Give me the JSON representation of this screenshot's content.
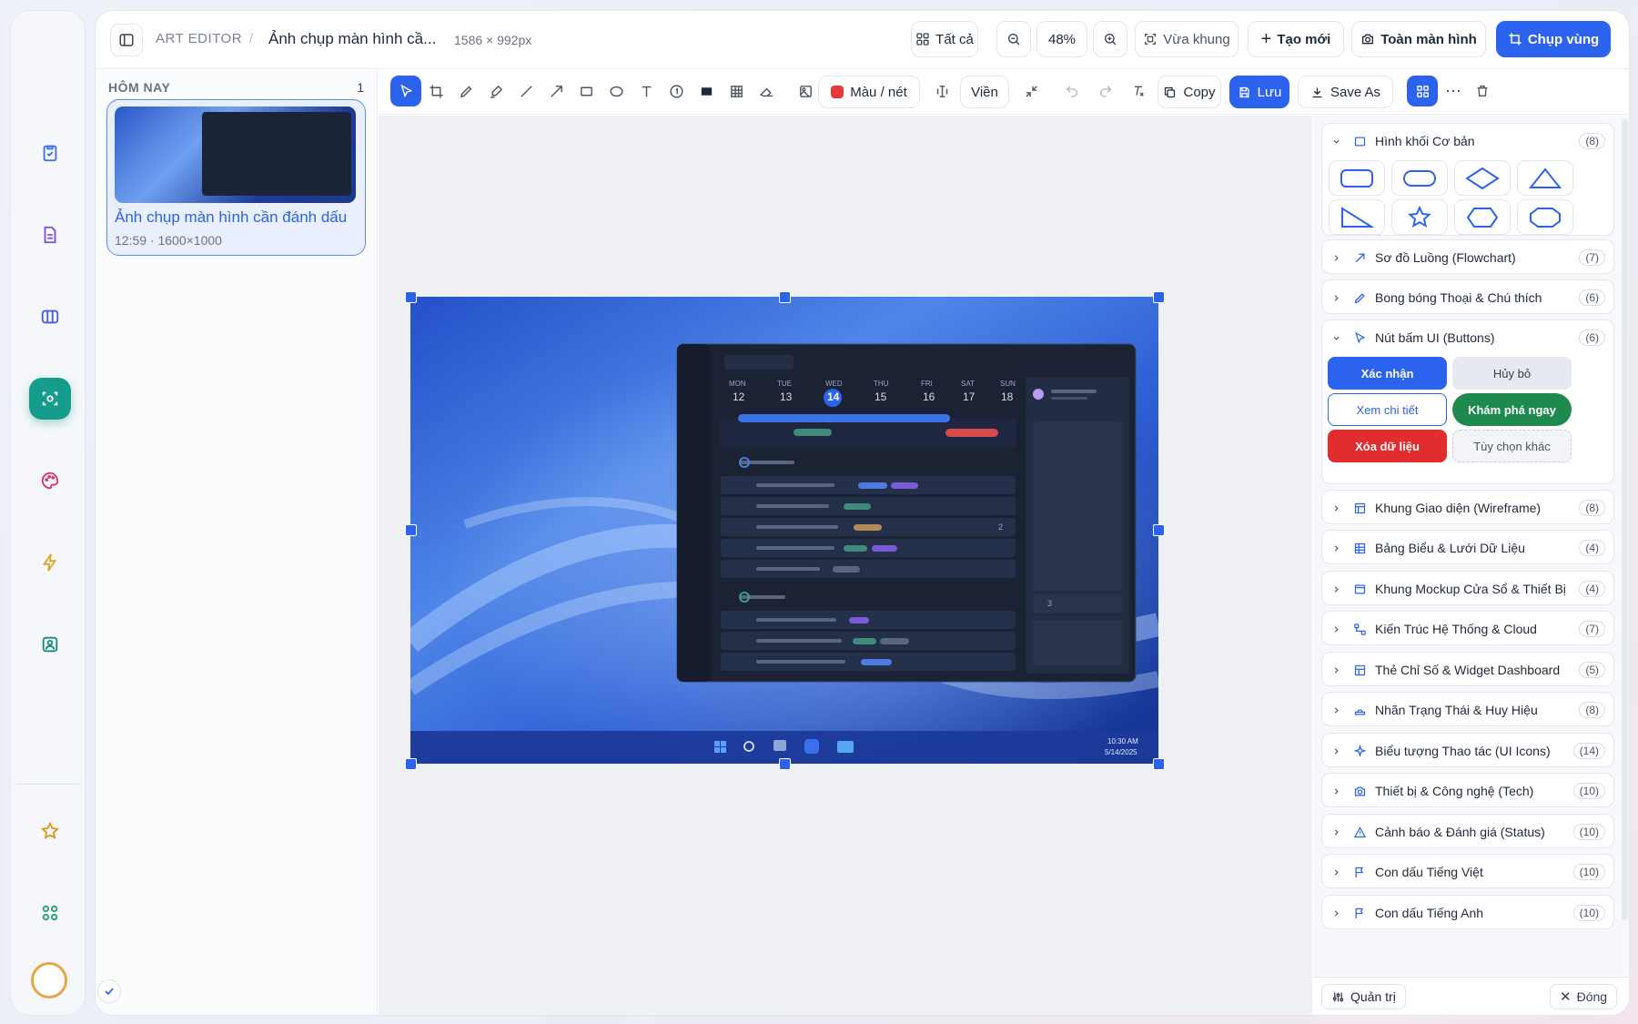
{
  "app": {
    "breadcrumb_root": "ART EDITOR",
    "breadcrumb_sep": "/",
    "doc_title": "Ảnh chụp màn hình cầ...",
    "doc_dims": "1586 × 992px",
    "btn_all": "Tất cả",
    "zoom": "48%",
    "btn_fit": "Vừa khung",
    "btn_new": "Tạo mới",
    "btn_fullscreen": "Toàn màn hình",
    "btn_capture": "Chụp vùng"
  },
  "sidebar": {
    "section": "HÔM NAY",
    "count": "1",
    "item_title": "Ảnh chụp màn hình cần đánh dấu",
    "item_sub": "12:59 · 1600×1000"
  },
  "toolbar": {
    "color_label": "Màu / nét",
    "border_label": "Viền",
    "copy": "Copy",
    "save": "Lưu",
    "save_as": "Save As",
    "accent": "#2c63ee",
    "stroke_color": "#e5383b"
  },
  "screenshot": {
    "days": [
      {
        "d": "MON",
        "n": "12"
      },
      {
        "d": "TUE",
        "n": "13"
      },
      {
        "d": "WED",
        "n": "14"
      },
      {
        "d": "THU",
        "n": "15"
      },
      {
        "d": "FRI",
        "n": "16"
      },
      {
        "d": "SAT",
        "n": "17"
      },
      {
        "d": "SUN",
        "n": "18"
      }
    ],
    "comment_count": "2",
    "attach_count": "3",
    "clock_time": "10:30 AM",
    "clock_date": "5/14/2025"
  },
  "panel": {
    "basic_shapes": {
      "title": "Hình khối Cơ bản",
      "count": "(8)"
    },
    "flowchart": {
      "title": "Sơ đồ Luồng (Flowchart)",
      "count": "(7)"
    },
    "bubbles": {
      "title": "Bong bóng Thoại & Chú thích",
      "count": "(6)"
    },
    "ui_buttons": {
      "title": "Nút bấm UI (Buttons)",
      "count": "(6)"
    },
    "buttons": {
      "confirm": "Xác nhận",
      "cancel": "Hủy bỏ",
      "details": "Xem chi tiết",
      "explore": "Khám phá ngay",
      "delete": "Xóa dữ liệu",
      "other": "Tùy chọn khác"
    },
    "wireframe": {
      "title": "Khung Giao diện (Wireframe)",
      "count": "(8)"
    },
    "tables": {
      "title": "Bảng Biểu & Lưới Dữ Liệu",
      "count": "(4)"
    },
    "mockups": {
      "title": "Khung Mockup Cửa Sổ & Thiết Bị",
      "count": "(4)"
    },
    "arch": {
      "title": "Kiến Trúc Hệ Thống & Cloud",
      "count": "(7)"
    },
    "widgets": {
      "title": "Thẻ Chỉ Số & Widget Dashboard",
      "count": "(5)"
    },
    "badges": {
      "title": "Nhãn Trạng Thái & Huy Hiệu",
      "count": "(8)"
    },
    "icons": {
      "title": "Biểu tượng Thao tác (UI Icons)",
      "count": "(14)"
    },
    "tech": {
      "title": "Thiết bị & Công nghệ (Tech)",
      "count": "(10)"
    },
    "status": {
      "title": "Cảnh báo & Đánh giá (Status)",
      "count": "(10)"
    },
    "stamps_vi": {
      "title": "Con dấu Tiếng Việt",
      "count": "(10)"
    },
    "stamps_en": {
      "title": "Con dấu Tiếng Anh",
      "count": "(10)"
    },
    "admin": "Quản trị",
    "close": "Đóng"
  }
}
